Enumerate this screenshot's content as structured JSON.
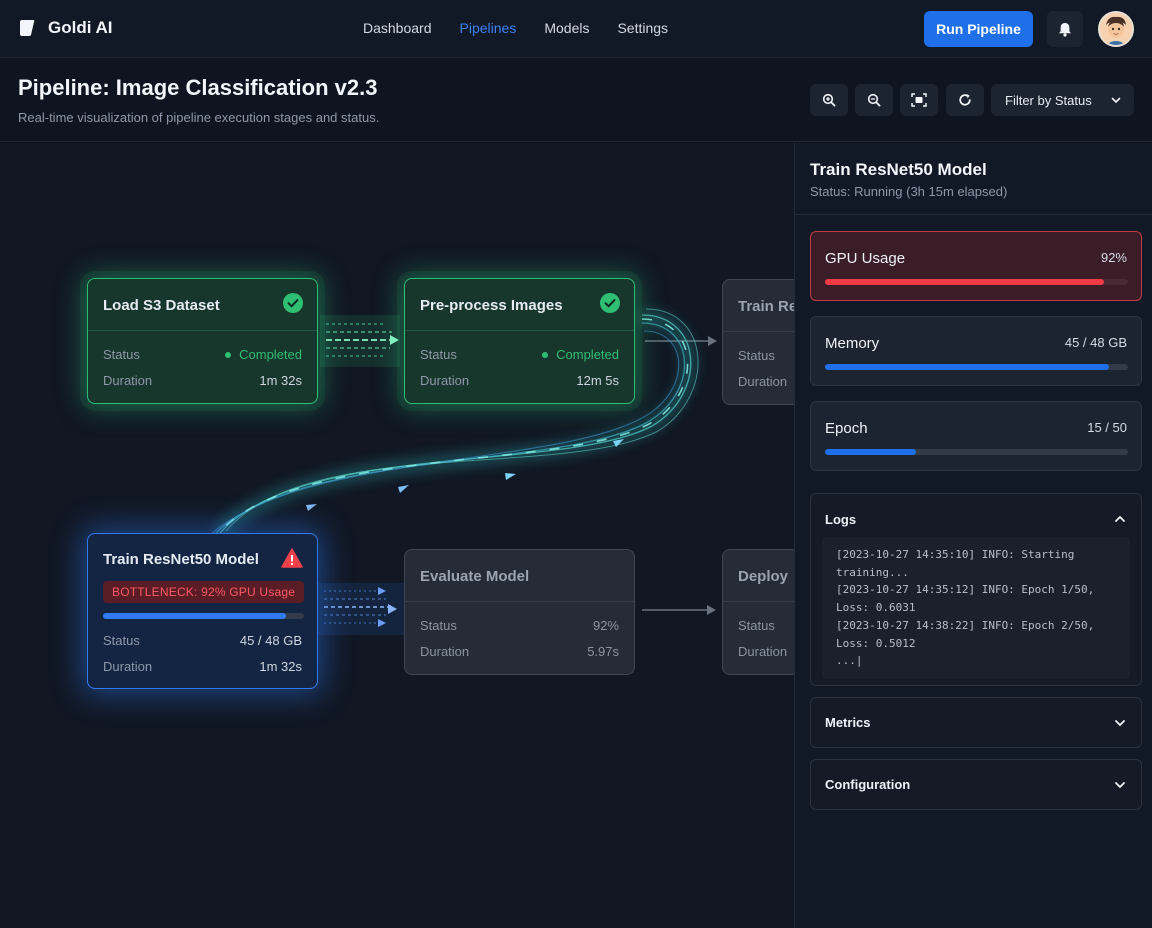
{
  "app": {
    "name": "Goldi AI"
  },
  "nav": {
    "links": [
      {
        "label": "Dashboard",
        "active": false
      },
      {
        "label": "Pipelines",
        "active": true
      },
      {
        "label": "Models",
        "active": false
      },
      {
        "label": "Settings",
        "active": false
      }
    ],
    "run_button": "Run Pipeline",
    "icons": {
      "notifications": "bell-icon",
      "profile": "avatar"
    }
  },
  "header": {
    "title": "Pipeline: Image Classification v2.3",
    "subtitle": "Real-time visualization of pipeline execution stages and status.",
    "tools": [
      "zoom-in-icon",
      "zoom-out-icon",
      "fit-view-icon",
      "refresh-icon"
    ],
    "filter_label": "Filter by Status"
  },
  "pipeline": {
    "load": {
      "title": "Load S3 Dataset",
      "status_label": "Status",
      "status_value": "Completed",
      "duration_label": "Duration",
      "duration_value": "1m 32s"
    },
    "preprocess": {
      "title": "Pre-process Images",
      "status_label": "Status",
      "status_value": "Completed",
      "duration_label": "Duration",
      "duration_value": "12m 5s"
    },
    "train_partial": {
      "title": "Train Re",
      "status_label": "Status",
      "duration_label": "Duration"
    },
    "train": {
      "title": "Train ResNet50 Model",
      "alert_prefix": "BOTTLENECK:",
      "alert_text": "92% GPU Usage",
      "progress": 0.91,
      "status_label": "Status",
      "status_value": "45 / 48 GB",
      "duration_label": "Duration",
      "duration_value": "1m 32s"
    },
    "evaluate": {
      "title": "Evaluate Model",
      "status_label": "Status",
      "status_value": "92%",
      "duration_label": "Duration",
      "duration_value": "5.97s"
    },
    "deploy": {
      "title": "Deploy",
      "status_label": "Status",
      "duration_label": "Duration"
    }
  },
  "detail": {
    "title": "Train ResNet50 Model",
    "subtitle": "Status: Running (3h 15m elapsed)",
    "metrics": [
      {
        "label": "GPU Usage",
        "value": "92%",
        "fraction": 0.92,
        "alert": true,
        "color": "#ef3b45"
      },
      {
        "label": "Memory",
        "value": "45 / 48 GB",
        "fraction": 0.9375,
        "alert": false,
        "color": "#1f6fe8"
      },
      {
        "label": "Epoch",
        "value": "15 / 50",
        "fraction": 0.3,
        "alert": false,
        "color": "#1f6fe8"
      }
    ],
    "logs": {
      "title": "Logs",
      "lines": "[2023-10-27 14:35:10] INFO: Starting\ntraining...\n[2023-10-27 14:35:12] INFO: Epoch 1/50,\nLoss: 0.6031\n[2023-10-27 14:38:22] INFO: Epoch 2/50,\nLoss: 0.5012\n...|"
    },
    "sections": [
      {
        "title": "Metrics"
      },
      {
        "title": "Configuration"
      }
    ]
  },
  "colors": {
    "accent": "#1f6fe8",
    "success": "#2fbf72",
    "danger": "#ef3b45",
    "active_nav": "#3b82f6"
  }
}
